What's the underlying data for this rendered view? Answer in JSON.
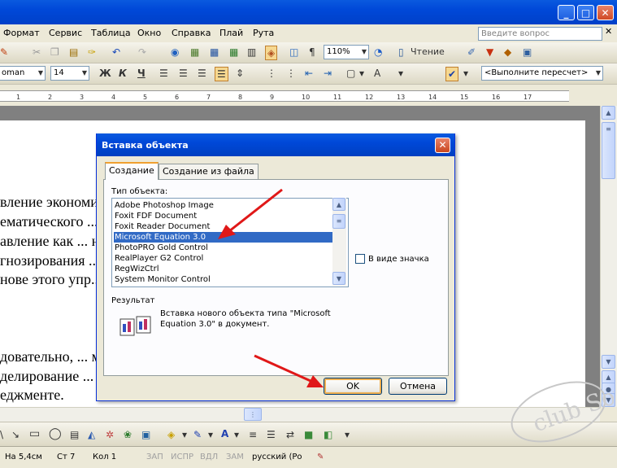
{
  "menu": [
    "Формат",
    "Сервис",
    "Таблица",
    "Окно",
    "Справка",
    "Плай",
    "Рута"
  ],
  "ask_placeholder": "Введите вопрос",
  "toolbar1": {
    "zoom": "110%",
    "reading": "Чтение"
  },
  "toolbar2": {
    "font": "oman",
    "size": "14",
    "bold": "Ж",
    "italic": "К",
    "underline": "Ч",
    "style_combo": "<Выполните пересчет>",
    "pilcrow": "¶"
  },
  "ruler_numbers": [
    "1",
    "2",
    "3",
    "4",
    "5",
    "6",
    "7",
    "8",
    "9",
    "10",
    "11",
    "12",
    "13",
    "14",
    "15",
    "16",
    "17"
  ],
  "document_lines": [
    "вление экономической ... и метода",
    "ематического ... ффективное",
    "авление как ... на уровне",
    "гнозирования ... ринятия на",
    "нове этого упр... лом.",
    "довательно, ... матическое",
    "делирование ... решений в",
    "еджменте."
  ],
  "dialog": {
    "title": "Вставка объекта",
    "close": "✕",
    "tab_create": "Создание",
    "tab_from_file": "Создание из файла",
    "type_label": "Тип объекта:",
    "items": [
      "Adobe Photoshop Image",
      "Foxit FDF Document",
      "Foxit Reader Document",
      "Microsoft Equation 3.0",
      "PhotoPRO Gold Control",
      "RealPlayer G2 Control",
      "RegWizCtrl",
      "System Monitor Control"
    ],
    "selected_index": 3,
    "as_icon": "В виде значка",
    "result_label": "Результат",
    "result_text": "Вставка нового объекта типа \"Microsoft Equation 3.0\" в документ.",
    "ok": "OK",
    "cancel": "Отмена"
  },
  "status": {
    "position": "На 5,4см",
    "line": "Ст 7",
    "column": "Кол 1",
    "rec": "ЗАП",
    "trk": "ИСПР",
    "ext": "ВДЛ",
    "ovr": "ЗАМ",
    "language": "русский (Ро"
  },
  "watermark": "club Sovet",
  "colors": {
    "titlebar": "#0048d8",
    "selection": "#316ac5",
    "arrow": "#e01818"
  }
}
